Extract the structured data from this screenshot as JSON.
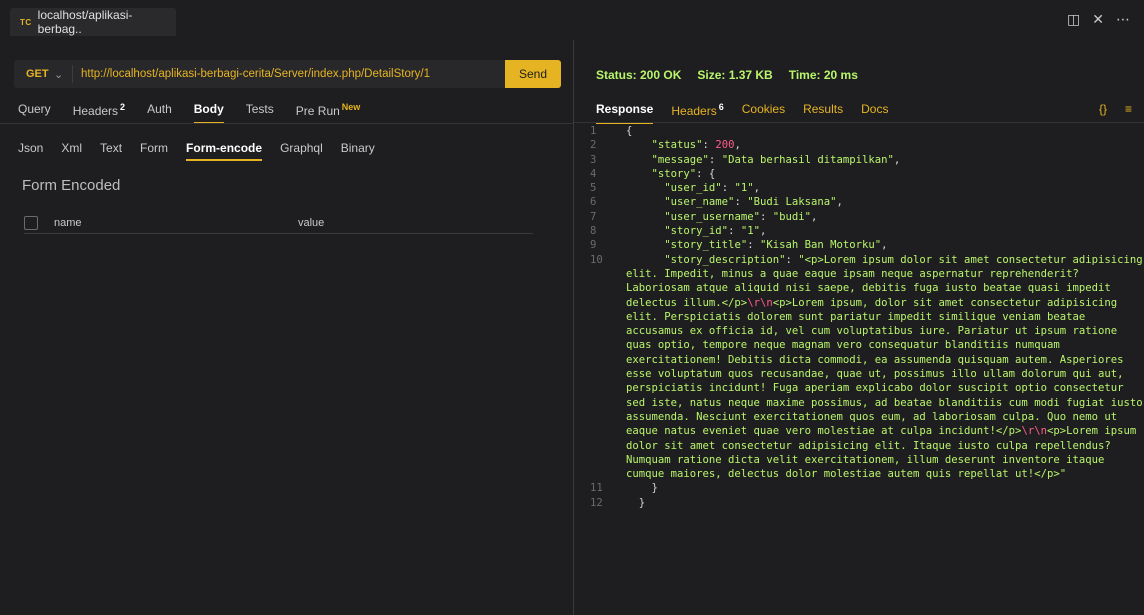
{
  "window": {
    "tab_badge": "TC",
    "tab_title": "localhost/aplikasi-berbag.."
  },
  "request": {
    "method": "GET",
    "url": "http://localhost/aplikasi-berbagi-cerita/Server/index.php/DetailStory/1",
    "send_label": "Send",
    "tabs": [
      {
        "label": "Query"
      },
      {
        "label": "Headers",
        "badge": "2"
      },
      {
        "label": "Auth"
      },
      {
        "label": "Body"
      },
      {
        "label": "Tests"
      },
      {
        "label": "Pre Run",
        "badge": "New"
      }
    ],
    "body_tabs": [
      "Json",
      "Xml",
      "Text",
      "Form",
      "Form-encode",
      "Graphql",
      "Binary"
    ],
    "form_title": "Form Encoded",
    "form_columns": {
      "name": "name",
      "value": "value"
    }
  },
  "response": {
    "status": "Status: 200 OK",
    "size": "Size: 1.37 KB",
    "time": "Time: 20 ms",
    "tabs": [
      {
        "label": "Response"
      },
      {
        "label": "Headers",
        "badge": "6"
      },
      {
        "label": "Cookies"
      },
      {
        "label": "Results"
      },
      {
        "label": "Docs"
      }
    ],
    "icons": [
      "braces-icon",
      "menu-icon"
    ],
    "json": {
      "k_status": "\"status\"",
      "v_status": "200",
      "k_message": "\"message\"",
      "v_message": "\"Data berhasil ditampilkan\"",
      "k_story": "\"story\"",
      "k_user_id": "\"user_id\"",
      "v_user_id": "\"1\"",
      "k_user_name": "\"user_name\"",
      "v_user_name": "\"Budi Laksana\"",
      "k_user_username": "\"user_username\"",
      "v_user_username": "\"budi\"",
      "k_story_id": "\"story_id\"",
      "v_story_id": "\"1\"",
      "k_story_title": "\"story_title\"",
      "v_story_title": "\"Kisah Ban Motorku\"",
      "k_story_description": "\"story_description\"",
      "desc_1": "\"<p>Lorem ipsum dolor sit amet consectetur adipisicing elit. Impedit, minus a quae eaque ipsam neque aspernatur reprehenderit? Laboriosam atque aliquid nisi saepe, debitis fuga iusto beatae quasi impedit delectus illum.</p>",
      "esc_1": "\\r\\n",
      "desc_2": "<p>Lorem ipsum, dolor sit amet consectetur adipisicing elit. Perspiciatis dolorem sunt pariatur impedit similique veniam beatae accusamus ex officia id, vel cum voluptatibus iure. Pariatur ut ipsum ratione quas optio, tempore neque magnam vero consequatur blanditiis numquam exercitationem! Debitis dicta commodi, ea assumenda quisquam autem. Asperiores esse voluptatum quos recusandae, quae ut, possimus illo ullam dolorum qui aut, perspiciatis incidunt! Fuga aperiam explicabo dolor suscipit optio consectetur sed iste, natus neque maxime possimus, ad beatae blanditiis cum modi fugiat iusto assumenda. Nesciunt exercitationem quos eum, ad laboriosam culpa. Quo nemo ut eaque natus eveniet quae vero molestiae at culpa incidunt!</p>",
      "esc_2": "\\r\\n",
      "desc_3": "<p>Lorem ipsum dolor sit amet consectetur adipisicing elit. Itaque iusto culpa repellendus? Numquam ratione dicta velit exercitationem, illum deserunt inventore itaque cumque maiores, delectus dolor molestiae autem quis repellat ut!</p>\""
    }
  }
}
